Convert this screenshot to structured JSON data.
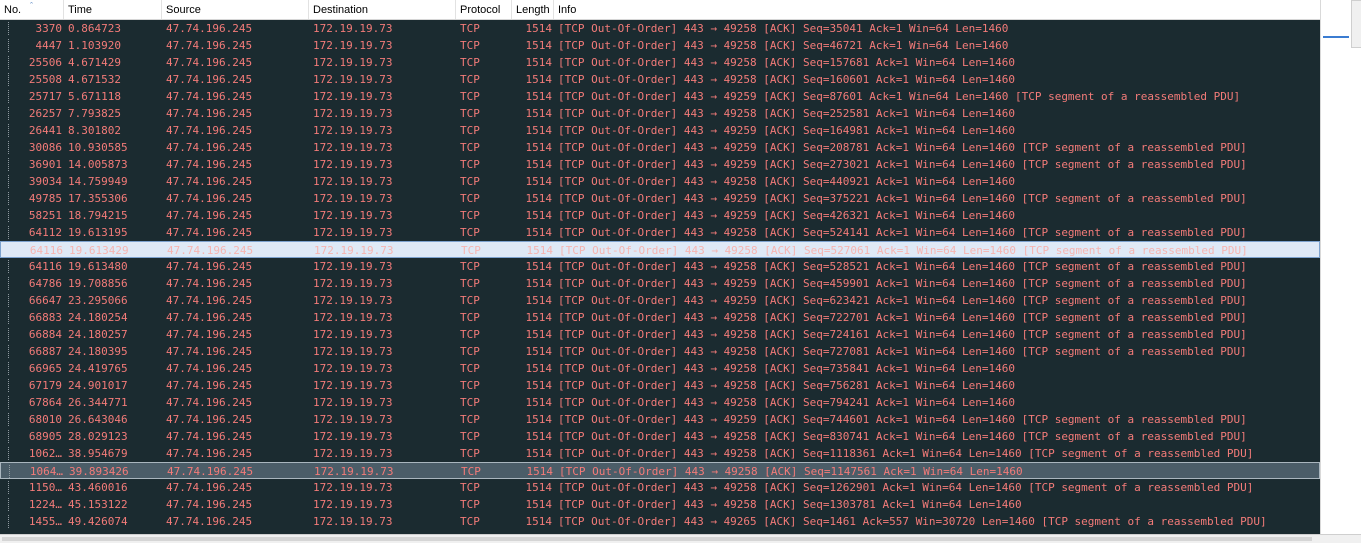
{
  "columns": {
    "no": "No.",
    "time": "Time",
    "source": "Source",
    "destination": "Destination",
    "protocol": "Protocol",
    "length": "Length",
    "info": "Info"
  },
  "sort_icon": "sort-ascending-icon",
  "colors": {
    "background": "#1b2b30",
    "row_text": "#f37b79",
    "selected_row_bg": "#dfe9f6",
    "highlight_row_bg": "#4b5d68",
    "scroll_mark": "#3b7cd1"
  },
  "packets": [
    {
      "no": "3370",
      "time": "0.864723",
      "source": "47.74.196.245",
      "destination": "172.19.19.73",
      "protocol": "TCP",
      "length": "1514",
      "info": "[TCP Out-Of-Order] 443 → 49258 [ACK] Seq=35041 Ack=1 Win=64 Len=1460"
    },
    {
      "no": "4447",
      "time": "1.103920",
      "source": "47.74.196.245",
      "destination": "172.19.19.73",
      "protocol": "TCP",
      "length": "1514",
      "info": "[TCP Out-Of-Order] 443 → 49258 [ACK] Seq=46721 Ack=1 Win=64 Len=1460"
    },
    {
      "no": "25506",
      "time": "4.671429",
      "source": "47.74.196.245",
      "destination": "172.19.19.73",
      "protocol": "TCP",
      "length": "1514",
      "info": "[TCP Out-Of-Order] 443 → 49258 [ACK] Seq=157681 Ack=1 Win=64 Len=1460"
    },
    {
      "no": "25508",
      "time": "4.671532",
      "source": "47.74.196.245",
      "destination": "172.19.19.73",
      "protocol": "TCP",
      "length": "1514",
      "info": "[TCP Out-Of-Order] 443 → 49258 [ACK] Seq=160601 Ack=1 Win=64 Len=1460"
    },
    {
      "no": "25717",
      "time": "5.671118",
      "source": "47.74.196.245",
      "destination": "172.19.19.73",
      "protocol": "TCP",
      "length": "1514",
      "info": "[TCP Out-Of-Order] 443 → 49259 [ACK] Seq=87601 Ack=1 Win=64 Len=1460 [TCP segment of a reassembled PDU]"
    },
    {
      "no": "26257",
      "time": "7.793825",
      "source": "47.74.196.245",
      "destination": "172.19.19.73",
      "protocol": "TCP",
      "length": "1514",
      "info": "[TCP Out-Of-Order] 443 → 49258 [ACK] Seq=252581 Ack=1 Win=64 Len=1460"
    },
    {
      "no": "26441",
      "time": "8.301802",
      "source": "47.74.196.245",
      "destination": "172.19.19.73",
      "protocol": "TCP",
      "length": "1514",
      "info": "[TCP Out-Of-Order] 443 → 49259 [ACK] Seq=164981 Ack=1 Win=64 Len=1460"
    },
    {
      "no": "30086",
      "time": "10.930585",
      "source": "47.74.196.245",
      "destination": "172.19.19.73",
      "protocol": "TCP",
      "length": "1514",
      "info": "[TCP Out-Of-Order] 443 → 49259 [ACK] Seq=208781 Ack=1 Win=64 Len=1460 [TCP segment of a reassembled PDU]"
    },
    {
      "no": "36901",
      "time": "14.005873",
      "source": "47.74.196.245",
      "destination": "172.19.19.73",
      "protocol": "TCP",
      "length": "1514",
      "info": "[TCP Out-Of-Order] 443 → 49259 [ACK] Seq=273021 Ack=1 Win=64 Len=1460 [TCP segment of a reassembled PDU]"
    },
    {
      "no": "39034",
      "time": "14.759949",
      "source": "47.74.196.245",
      "destination": "172.19.19.73",
      "protocol": "TCP",
      "length": "1514",
      "info": "[TCP Out-Of-Order] 443 → 49258 [ACK] Seq=440921 Ack=1 Win=64 Len=1460"
    },
    {
      "no": "49785",
      "time": "17.355306",
      "source": "47.74.196.245",
      "destination": "172.19.19.73",
      "protocol": "TCP",
      "length": "1514",
      "info": "[TCP Out-Of-Order] 443 → 49259 [ACK] Seq=375221 Ack=1 Win=64 Len=1460 [TCP segment of a reassembled PDU]"
    },
    {
      "no": "58251",
      "time": "18.794215",
      "source": "47.74.196.245",
      "destination": "172.19.19.73",
      "protocol": "TCP",
      "length": "1514",
      "info": "[TCP Out-Of-Order] 443 → 49259 [ACK] Seq=426321 Ack=1 Win=64 Len=1460"
    },
    {
      "no": "64112",
      "time": "19.613195",
      "source": "47.74.196.245",
      "destination": "172.19.19.73",
      "protocol": "TCP",
      "length": "1514",
      "info": "[TCP Out-Of-Order] 443 → 49258 [ACK] Seq=524141 Ack=1 Win=64 Len=1460 [TCP segment of a reassembled PDU]"
    },
    {
      "no": "64116",
      "time": "19.613429",
      "source": "47.74.196.245",
      "destination": "172.19.19.73",
      "protocol": "TCP",
      "length": "1514",
      "info": "[TCP Out-Of-Order] 443 → 49258 [ACK] Seq=527061 Ack=1 Win=64 Len=1460 [TCP segment of a reassembled PDU]",
      "state": "selected"
    },
    {
      "no": "64116",
      "time": "19.613480",
      "source": "47.74.196.245",
      "destination": "172.19.19.73",
      "protocol": "TCP",
      "length": "1514",
      "info": "[TCP Out-Of-Order] 443 → 49258 [ACK] Seq=528521 Ack=1 Win=64 Len=1460 [TCP segment of a reassembled PDU]"
    },
    {
      "no": "64786",
      "time": "19.708856",
      "source": "47.74.196.245",
      "destination": "172.19.19.73",
      "protocol": "TCP",
      "length": "1514",
      "info": "[TCP Out-Of-Order] 443 → 49259 [ACK] Seq=459901 Ack=1 Win=64 Len=1460 [TCP segment of a reassembled PDU]"
    },
    {
      "no": "66647",
      "time": "23.295066",
      "source": "47.74.196.245",
      "destination": "172.19.19.73",
      "protocol": "TCP",
      "length": "1514",
      "info": "[TCP Out-Of-Order] 443 → 49259 [ACK] Seq=623421 Ack=1 Win=64 Len=1460 [TCP segment of a reassembled PDU]"
    },
    {
      "no": "66883",
      "time": "24.180254",
      "source": "47.74.196.245",
      "destination": "172.19.19.73",
      "protocol": "TCP",
      "length": "1514",
      "info": "[TCP Out-Of-Order] 443 → 49258 [ACK] Seq=722701 Ack=1 Win=64 Len=1460 [TCP segment of a reassembled PDU]"
    },
    {
      "no": "66884",
      "time": "24.180257",
      "source": "47.74.196.245",
      "destination": "172.19.19.73",
      "protocol": "TCP",
      "length": "1514",
      "info": "[TCP Out-Of-Order] 443 → 49258 [ACK] Seq=724161 Ack=1 Win=64 Len=1460 [TCP segment of a reassembled PDU]"
    },
    {
      "no": "66887",
      "time": "24.180395",
      "source": "47.74.196.245",
      "destination": "172.19.19.73",
      "protocol": "TCP",
      "length": "1514",
      "info": "[TCP Out-Of-Order] 443 → 49258 [ACK] Seq=727081 Ack=1 Win=64 Len=1460 [TCP segment of a reassembled PDU]"
    },
    {
      "no": "66965",
      "time": "24.419765",
      "source": "47.74.196.245",
      "destination": "172.19.19.73",
      "protocol": "TCP",
      "length": "1514",
      "info": "[TCP Out-Of-Order] 443 → 49258 [ACK] Seq=735841 Ack=1 Win=64 Len=1460"
    },
    {
      "no": "67179",
      "time": "24.901017",
      "source": "47.74.196.245",
      "destination": "172.19.19.73",
      "protocol": "TCP",
      "length": "1514",
      "info": "[TCP Out-Of-Order] 443 → 49258 [ACK] Seq=756281 Ack=1 Win=64 Len=1460"
    },
    {
      "no": "67864",
      "time": "26.344771",
      "source": "47.74.196.245",
      "destination": "172.19.19.73",
      "protocol": "TCP",
      "length": "1514",
      "info": "[TCP Out-Of-Order] 443 → 49258 [ACK] Seq=794241 Ack=1 Win=64 Len=1460"
    },
    {
      "no": "68010",
      "time": "26.643046",
      "source": "47.74.196.245",
      "destination": "172.19.19.73",
      "protocol": "TCP",
      "length": "1514",
      "info": "[TCP Out-Of-Order] 443 → 49259 [ACK] Seq=744601 Ack=1 Win=64 Len=1460 [TCP segment of a reassembled PDU]"
    },
    {
      "no": "68905",
      "time": "28.029123",
      "source": "47.74.196.245",
      "destination": "172.19.19.73",
      "protocol": "TCP",
      "length": "1514",
      "info": "[TCP Out-Of-Order] 443 → 49258 [ACK] Seq=830741 Ack=1 Win=64 Len=1460 [TCP segment of a reassembled PDU]"
    },
    {
      "no": "1062…",
      "time": "38.954679",
      "source": "47.74.196.245",
      "destination": "172.19.19.73",
      "protocol": "TCP",
      "length": "1514",
      "info": "[TCP Out-Of-Order] 443 → 49258 [ACK] Seq=1118361 Ack=1 Win=64 Len=1460 [TCP segment of a reassembled PDU]"
    },
    {
      "no": "1064…",
      "time": "39.893426",
      "source": "47.74.196.245",
      "destination": "172.19.19.73",
      "protocol": "TCP",
      "length": "1514",
      "info": "[TCP Out-Of-Order] 443 → 49258 [ACK] Seq=1147561 Ack=1 Win=64 Len=1460",
      "state": "highlight"
    },
    {
      "no": "1150…",
      "time": "43.460016",
      "source": "47.74.196.245",
      "destination": "172.19.19.73",
      "protocol": "TCP",
      "length": "1514",
      "info": "[TCP Out-Of-Order] 443 → 49258 [ACK] Seq=1262901 Ack=1 Win=64 Len=1460 [TCP segment of a reassembled PDU]"
    },
    {
      "no": "1224…",
      "time": "45.153122",
      "source": "47.74.196.245",
      "destination": "172.19.19.73",
      "protocol": "TCP",
      "length": "1514",
      "info": "[TCP Out-Of-Order] 443 → 49258 [ACK] Seq=1303781 Ack=1 Win=64 Len=1460"
    },
    {
      "no": "1455…",
      "time": "49.426074",
      "source": "47.74.196.245",
      "destination": "172.19.19.73",
      "protocol": "TCP",
      "length": "1514",
      "info": "[TCP Out-Of-Order] 443 → 49265 [ACK] Seq=1461 Ack=557 Win=30720 Len=1460 [TCP segment of a reassembled PDU]"
    }
  ]
}
